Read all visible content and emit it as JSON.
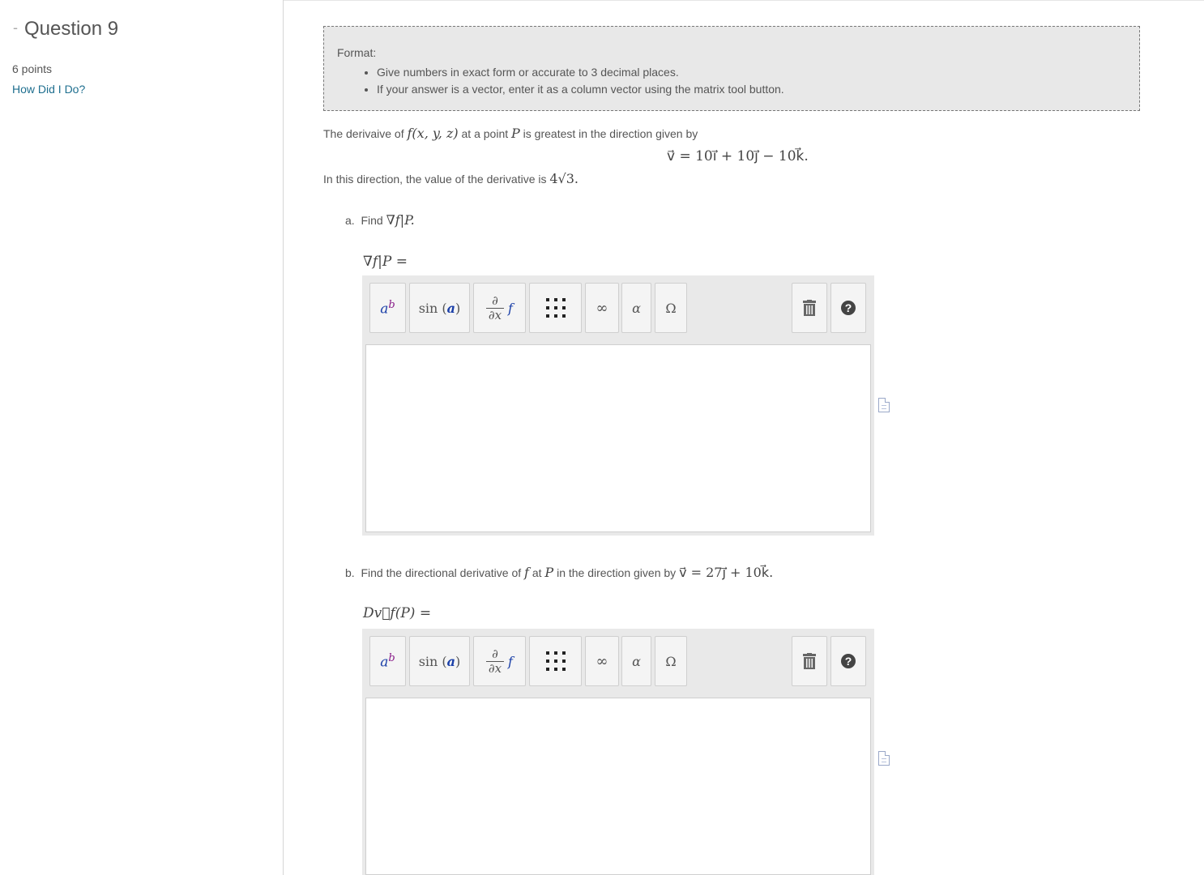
{
  "sidebar": {
    "dash": "-",
    "question_title": "Question 9",
    "points": "6 points",
    "how_did_i_do": "How Did I Do?"
  },
  "format_box": {
    "label": "Format:",
    "items": [
      "Give numbers in exact form or accurate to 3 decimal places.",
      "If your answer is a vector, enter it as a column vector using the matrix tool button."
    ]
  },
  "problem": {
    "intro_1": "The derivaive of",
    "intro_func": "f(x, y, z)",
    "intro_2": "at a point",
    "intro_point": "P",
    "intro_3": "is greatest in the direction given by",
    "direction_vector": "v⃗ = 10i⃗ + 10j⃗ − 10k⃗.",
    "value_text": "In this direction, the value of the derivative is",
    "value_math": "4√3."
  },
  "part_a": {
    "prefix": "a.",
    "prompt": "Find",
    "prompt_math": "∇f|P.",
    "answer_label": "∇f|P ="
  },
  "part_b": {
    "prefix": "b.",
    "prompt": "Find the directional derivative of",
    "prompt_f": "f",
    "prompt_at": "at",
    "prompt_p": "P",
    "prompt_dir": "in the direction given by",
    "prompt_vector": "v⃗ = 27j⃗ + 10k⃗.",
    "answer_label": "Dv⃗f(P) ="
  },
  "toolbar": {
    "power": "ab",
    "sin": "sin (a)",
    "deriv_top": "∂",
    "deriv_bottom": "∂x",
    "deriv_f": "f",
    "infinity": "∞",
    "alpha": "α",
    "omega": "Ω",
    "trash_icon": "trash-icon",
    "help_icon": "help-icon"
  },
  "colors": {
    "link": "#1f6f8f",
    "format_bg": "#e8e8e8",
    "toolbar_bg": "#e9e9e9",
    "accent_blue": "#1a3fa8",
    "accent_purple": "#8a1e8a"
  }
}
